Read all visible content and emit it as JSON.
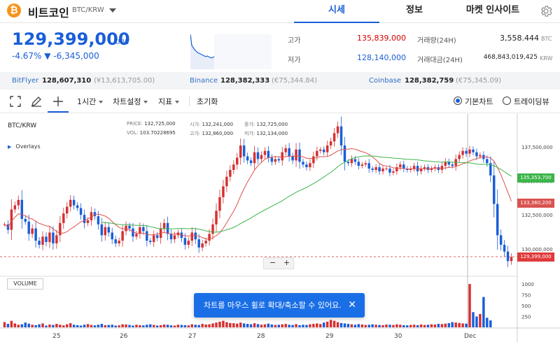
{
  "header": {
    "coin_symbol": "₿",
    "coin_name": "비트코인",
    "pair": "BTC/KRW",
    "tabs": [
      {
        "label": "시세",
        "active": true
      },
      {
        "label": "정보",
        "active": false
      },
      {
        "label": "마켓 인사이트",
        "active": false
      }
    ],
    "settings_icon": "gear-icon"
  },
  "price": {
    "current": "129,399,000",
    "unit": "KRW",
    "change": "-4.67% ▼ -6,345,000",
    "color": "#1a5ed8",
    "high_label": "고가",
    "high": "135,839,000",
    "low_label": "저가",
    "low": "128,140,000",
    "volume_label": "거래량(24H)",
    "volume": "3,558.444",
    "volume_unit": "BTC",
    "amount_label": "거래대금(24H)",
    "amount": "468,843,019,425",
    "amount_unit": "KRW"
  },
  "exchanges": [
    {
      "name": "BitFlyer",
      "price": "128,607,310",
      "sub": "(¥13,613,705.00)"
    },
    {
      "name": "Binance",
      "price": "128,382,333",
      "sub": "(€75,344.84)"
    },
    {
      "name": "Coinbase",
      "price": "128,382,759",
      "sub": "(€75,345.09)"
    }
  ],
  "toolbar": {
    "interval": "1시간",
    "chart_settings": "차트설정",
    "indicators": "지표",
    "reset": "초기화",
    "basic_chart": "기본차트",
    "trading_view": "트레이딩뷰"
  },
  "chart": {
    "pair": "BTC/KRW",
    "overlays": "Overlays",
    "tooltip": {
      "price_label": "PRICE:",
      "price": "132,725,000",
      "vol_label": "VOL:",
      "vol": "103.70228695",
      "open_label": "시가:",
      "open": "132,241,000",
      "high_label": "고가:",
      "high": "132,860,000",
      "close_label": "종가:",
      "close": "132,725,000",
      "low_label": "저가:",
      "low": "132,134,000"
    },
    "volume_label": "VOLUME",
    "zoom_minus": "−",
    "zoom_plus": "+",
    "toast": "차트를 마우스 휠로 확대/축소할 수 있어요.",
    "toast_close": "✕",
    "price_ticks": [
      "137,500,000",
      "135,000,000",
      "132,500,000",
      "130,000,000"
    ],
    "vol_ticks": [
      "1000",
      "750",
      "500",
      "250"
    ],
    "x_ticks": [
      "25",
      "26",
      "27",
      "28",
      "29",
      "30",
      "Dec"
    ],
    "tags": [
      {
        "label": "135,353,700",
        "color": "#3cb54a"
      },
      {
        "label": "133,360,200",
        "color": "#d9534f"
      },
      {
        "label": "129,399,000",
        "color": "#e03a3a"
      }
    ]
  },
  "chart_data": {
    "type": "candlestick",
    "ylim": [
      128500000,
      139500000
    ],
    "candles_close": [
      131800000,
      131400000,
      132900000,
      133200000,
      133600000,
      132200000,
      132000000,
      131100000,
      131500000,
      130600000,
      130300000,
      130900000,
      130500000,
      131200000,
      130400000,
      131000000,
      131900000,
      132600000,
      133100000,
      133600000,
      133200000,
      133000000,
      132500000,
      131900000,
      132100000,
      132700000,
      132400000,
      131800000,
      131000000,
      131600000,
      131200000,
      130700000,
      130400000,
      130600000,
      131300000,
      131700000,
      131500000,
      130900000,
      131100000,
      131600000,
      131300000,
      130600000,
      130500000,
      131000000,
      130800000,
      131500000,
      131900000,
      131100000,
      130700000,
      131000000,
      131200000,
      130800000,
      130300000,
      130600000,
      131200000,
      130700000,
      130100000,
      130400000,
      130600000,
      131100000,
      131800000,
      132800000,
      133800000,
      134600000,
      135300000,
      135800000,
      136200000,
      136700000,
      137600000,
      136800000,
      136500000,
      136300000,
      137100000,
      136600000,
      136900000,
      137200000,
      136700000,
      136400000,
      136600000,
      136500000,
      137100000,
      137400000,
      136800000,
      136500000,
      137300000,
      136400000,
      136200000,
      136000000,
      136300000,
      136800000,
      137200000,
      137300000,
      137100000,
      137600000,
      137900000,
      138500000,
      139000000,
      137600000,
      136400000,
      136300000,
      136600000,
      136400000,
      136100000,
      136200000,
      136300000,
      135900000,
      135800000,
      136000000,
      135700000,
      135900000,
      135900000,
      135600000,
      135700000,
      136000000,
      136200000,
      135900000,
      135800000,
      135900000,
      136100000,
      135700000,
      135900000,
      136000000,
      135800000,
      135900000,
      136000000,
      135800000,
      136100000,
      136400000,
      136200000,
      136100000,
      136600000,
      136900000,
      137200000,
      137000000,
      137300000,
      137100000,
      136800000,
      136900000,
      136600000,
      136300000,
      135400000,
      133300000,
      131000000,
      130300000,
      129800000,
      129100000,
      129400000
    ],
    "ma_fast_label": "red MA",
    "ma_slow_label": "green MA",
    "volumes": [
      120,
      80,
      150,
      90,
      60,
      70,
      110,
      85,
      60,
      50,
      70,
      90,
      40,
      65,
      55,
      80,
      60,
      45,
      70,
      95,
      60,
      50,
      40,
      60,
      75,
      55,
      45,
      60,
      80,
      50,
      55,
      60,
      40,
      45,
      70,
      65,
      55,
      40,
      60,
      50,
      45,
      60,
      70,
      55,
      40,
      50,
      65,
      60,
      45,
      40,
      60,
      55,
      50,
      45,
      70,
      60,
      55,
      80,
      65,
      70,
      90,
      110,
      130,
      150,
      120,
      100,
      95,
      85,
      110,
      90,
      80,
      70,
      95,
      75,
      60,
      70,
      85,
      65,
      55,
      60,
      70,
      80,
      60,
      55,
      75,
      50,
      60,
      55,
      70,
      80,
      90,
      75,
      110,
      130,
      170,
      150,
      120,
      100,
      90,
      80,
      70,
      60,
      75,
      65,
      55,
      60,
      70,
      60,
      55,
      50,
      65,
      60,
      55,
      70,
      60,
      50,
      45,
      55,
      60,
      50,
      65,
      55,
      60,
      70,
      65,
      80,
      75,
      85,
      95,
      120,
      110,
      100,
      90,
      85,
      1000,
      350,
      250,
      310,
      700,
      220,
      160
    ]
  }
}
